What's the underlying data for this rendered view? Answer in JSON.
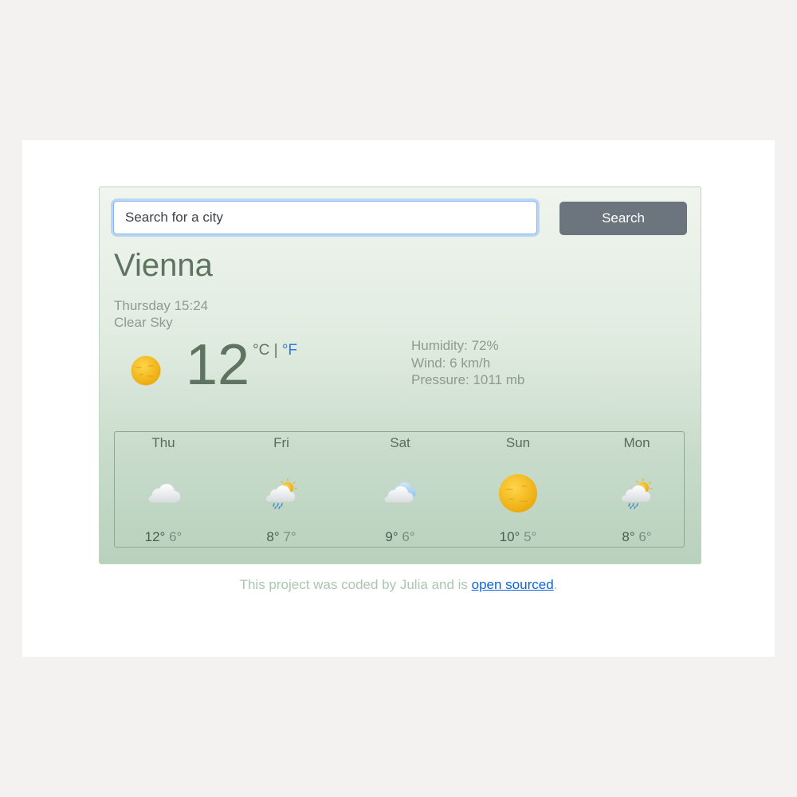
{
  "search": {
    "placeholder": "Search for a city",
    "button_label": "Search"
  },
  "current": {
    "city": "Vienna",
    "date": "Thursday 15:24",
    "description": "Clear Sky",
    "icon": "sun-icon",
    "temperature": "12",
    "unit_celsius": "°C",
    "unit_separator": "|",
    "unit_fahrenheit": "°F",
    "humidity": "Humidity: 72%",
    "wind": "Wind: 6 km/h",
    "pressure": "Pressure: 1011 mb"
  },
  "forecast": [
    {
      "day": "Thu",
      "icon": "cloud-icon",
      "max": "12°",
      "min": "6°"
    },
    {
      "day": "Fri",
      "icon": "rain-sun-cloud-icon",
      "max": "8°",
      "min": "7°"
    },
    {
      "day": "Sat",
      "icon": "cloud-icon",
      "max": "9°",
      "min": "6°"
    },
    {
      "day": "Sun",
      "icon": "sun-icon",
      "max": "10°",
      "min": "5°"
    },
    {
      "day": "Mon",
      "icon": "rain-sun-cloud-icon",
      "max": "8°",
      "min": "6°"
    }
  ],
  "footer": {
    "text": "This project was coded by Julia and is ",
    "link": "open sourced",
    "end": "."
  },
  "colors": {
    "accent_link": "#0d63d4",
    "fahrenheit_link": "#2c7be5",
    "button": "#6c757d",
    "sun": "#f5b914"
  }
}
